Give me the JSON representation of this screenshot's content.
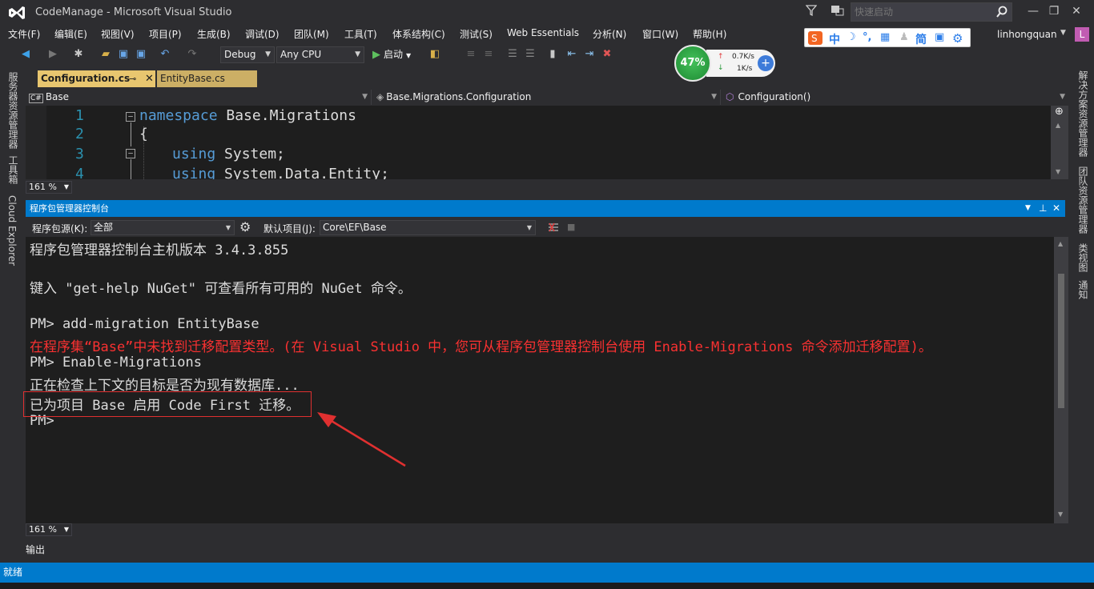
{
  "window": {
    "title": "CodeManage - Microsoft Visual Studio",
    "quick_launch_placeholder": "快速启动",
    "user_name": "linhongquan",
    "user_initial": "L"
  },
  "menu": [
    "文件(F)",
    "编辑(E)",
    "视图(V)",
    "项目(P)",
    "生成(B)",
    "调试(D)",
    "团队(M)",
    "工具(T)",
    "体系结构(C)",
    "测试(S)",
    "Web Essentials",
    "分析(N)",
    "窗口(W)",
    "帮助(H)"
  ],
  "ime": {
    "chars": [
      "中",
      "简"
    ]
  },
  "toolbar": {
    "config": "Debug",
    "platform": "Any CPU",
    "start_label": "启动"
  },
  "speed_widget": {
    "percent": "47%",
    "up": "0.7K/s",
    "down": "1K/s"
  },
  "left_strip": [
    "服务器资源管理器",
    "工具箱",
    "Cloud Explorer"
  ],
  "right_strip": [
    "解决方案资源管理器",
    "团队资源管理器",
    "类视图",
    "通知"
  ],
  "editor": {
    "tabs": [
      {
        "label": "Configuration.cs",
        "active": true
      },
      {
        "label": "EntityBase.cs",
        "active": false
      }
    ],
    "nav": {
      "project": "Base",
      "type": "Base.Migrations.Configuration",
      "member": "Configuration()"
    },
    "lines": [
      {
        "num": "1",
        "kw": "namespace",
        "rest": " Base.Migrations"
      },
      {
        "num": "2",
        "kw": "",
        "rest": "{"
      },
      {
        "num": "3",
        "kw": "using",
        "rest": " System;"
      },
      {
        "num": "4",
        "kw": "using",
        "rest": " System.Data.Entity;"
      }
    ],
    "zoom": "161 %"
  },
  "pmc": {
    "title": "程序包管理器控制台",
    "source_label": "程序包源(K):",
    "source_value": "全部",
    "project_label": "默认项目(J):",
    "project_value": "Core\\EF\\Base",
    "lines": [
      {
        "text": "程序包管理器控制台主机版本 3.4.3.855",
        "type": "normal"
      },
      {
        "text": "",
        "type": "normal"
      },
      {
        "text": "键入 \"get-help NuGet\" 可查看所有可用的 NuGet 命令。",
        "type": "normal"
      },
      {
        "text": "",
        "type": "normal"
      },
      {
        "text": "PM> add-migration EntityBase",
        "type": "normal"
      },
      {
        "text": "在程序集“Base”中未找到迁移配置类型。(在 Visual Studio 中，您可从程序包管理器控制台使用 Enable-Migrations 命令添加迁移配置)。",
        "type": "error"
      },
      {
        "text": "PM> Enable-Migrations",
        "type": "normal"
      },
      {
        "text": "正在检查上下文的目标是否为现有数据库...",
        "type": "normal"
      },
      {
        "text": "已为项目 Base 启用 Code First 迁移。",
        "type": "normal"
      },
      {
        "text": "PM>",
        "type": "normal"
      }
    ],
    "zoom": "161 %"
  },
  "output_tab": "输出",
  "status": "就绪",
  "colors": {
    "accent": "#007acc",
    "error": "#f93131",
    "tab_active": "#e8c66f",
    "annotation": "#e03030"
  }
}
